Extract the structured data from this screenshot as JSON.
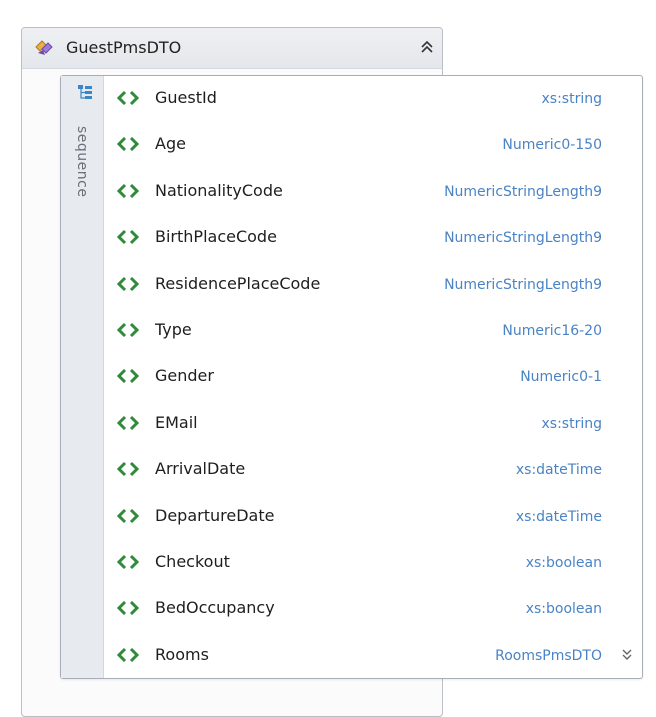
{
  "complex_type": {
    "name": "GuestPmsDTO",
    "icon": "complex-type-icon",
    "collapse_icon": "double-chevron-up-icon"
  },
  "sequence": {
    "label": "sequence",
    "icon": "sequence-icon"
  },
  "elements": [
    {
      "name": "GuestId",
      "type": "xs:string"
    },
    {
      "name": "Age",
      "type": "Numeric0-150"
    },
    {
      "name": "NationalityCode",
      "type": "NumericStringLength9"
    },
    {
      "name": "BirthPlaceCode",
      "type": "NumericStringLength9"
    },
    {
      "name": "ResidencePlaceCode",
      "type": "NumericStringLength9"
    },
    {
      "name": "Type",
      "type": "Numeric16-20"
    },
    {
      "name": "Gender",
      "type": "Numeric0-1"
    },
    {
      "name": "EMail",
      "type": "xs:string"
    },
    {
      "name": "ArrivalDate",
      "type": "xs:dateTime"
    },
    {
      "name": "DepartureDate",
      "type": "xs:dateTime"
    },
    {
      "name": "Checkout",
      "type": "xs:boolean"
    },
    {
      "name": "BedOccupancy",
      "type": "xs:boolean"
    },
    {
      "name": "Rooms",
      "type": "RoomsPmsDTO",
      "expandable": true
    }
  ],
  "colors": {
    "type_text": "#4a83c4",
    "element_icon": "#2f8a3a"
  }
}
